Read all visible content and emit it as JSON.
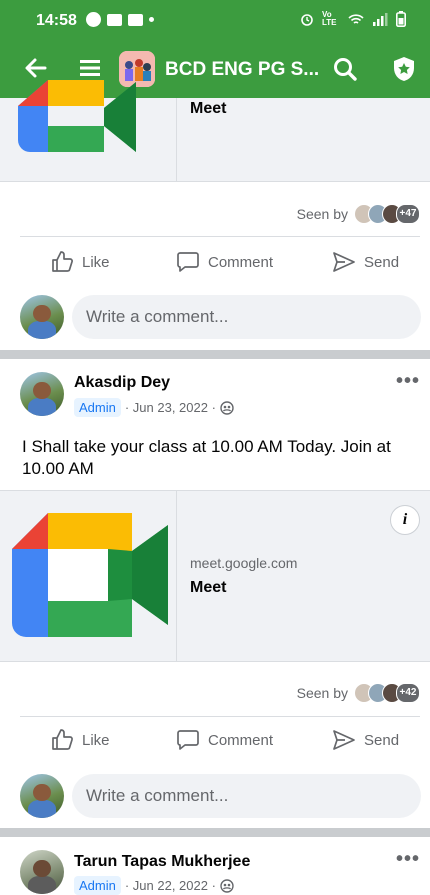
{
  "status": {
    "time": "14:58",
    "network_label": "Vo LTE"
  },
  "appbar": {
    "group_title": "BCD ENG PG S..."
  },
  "post1": {
    "link_title": "Meet",
    "seen_label": "Seen by",
    "seen_count": "+47",
    "actions": {
      "like": "Like",
      "comment": "Comment",
      "send": "Send"
    },
    "comment_placeholder": "Write a comment..."
  },
  "post2": {
    "author": "Akasdip Dey",
    "badge": "Admin",
    "meta": "· Jun 23, 2022 ·",
    "text": "I Shall take your class at 10.00 AM Today. Join at 10.00 AM",
    "link_domain": "meet.google.com",
    "link_title": "Meet",
    "seen_label": "Seen by",
    "seen_count": "+42",
    "actions": {
      "like": "Like",
      "comment": "Comment",
      "send": "Send"
    },
    "comment_placeholder": "Write a comment..."
  },
  "post3": {
    "author": "Tarun Tapas Mukherjee",
    "badge": "Admin",
    "meta": "· Jun 22, 2022 ·"
  },
  "colors": {
    "header_green": "#3c9c3f",
    "admin_blue": "#1877f2",
    "muted_text": "#65676b"
  }
}
